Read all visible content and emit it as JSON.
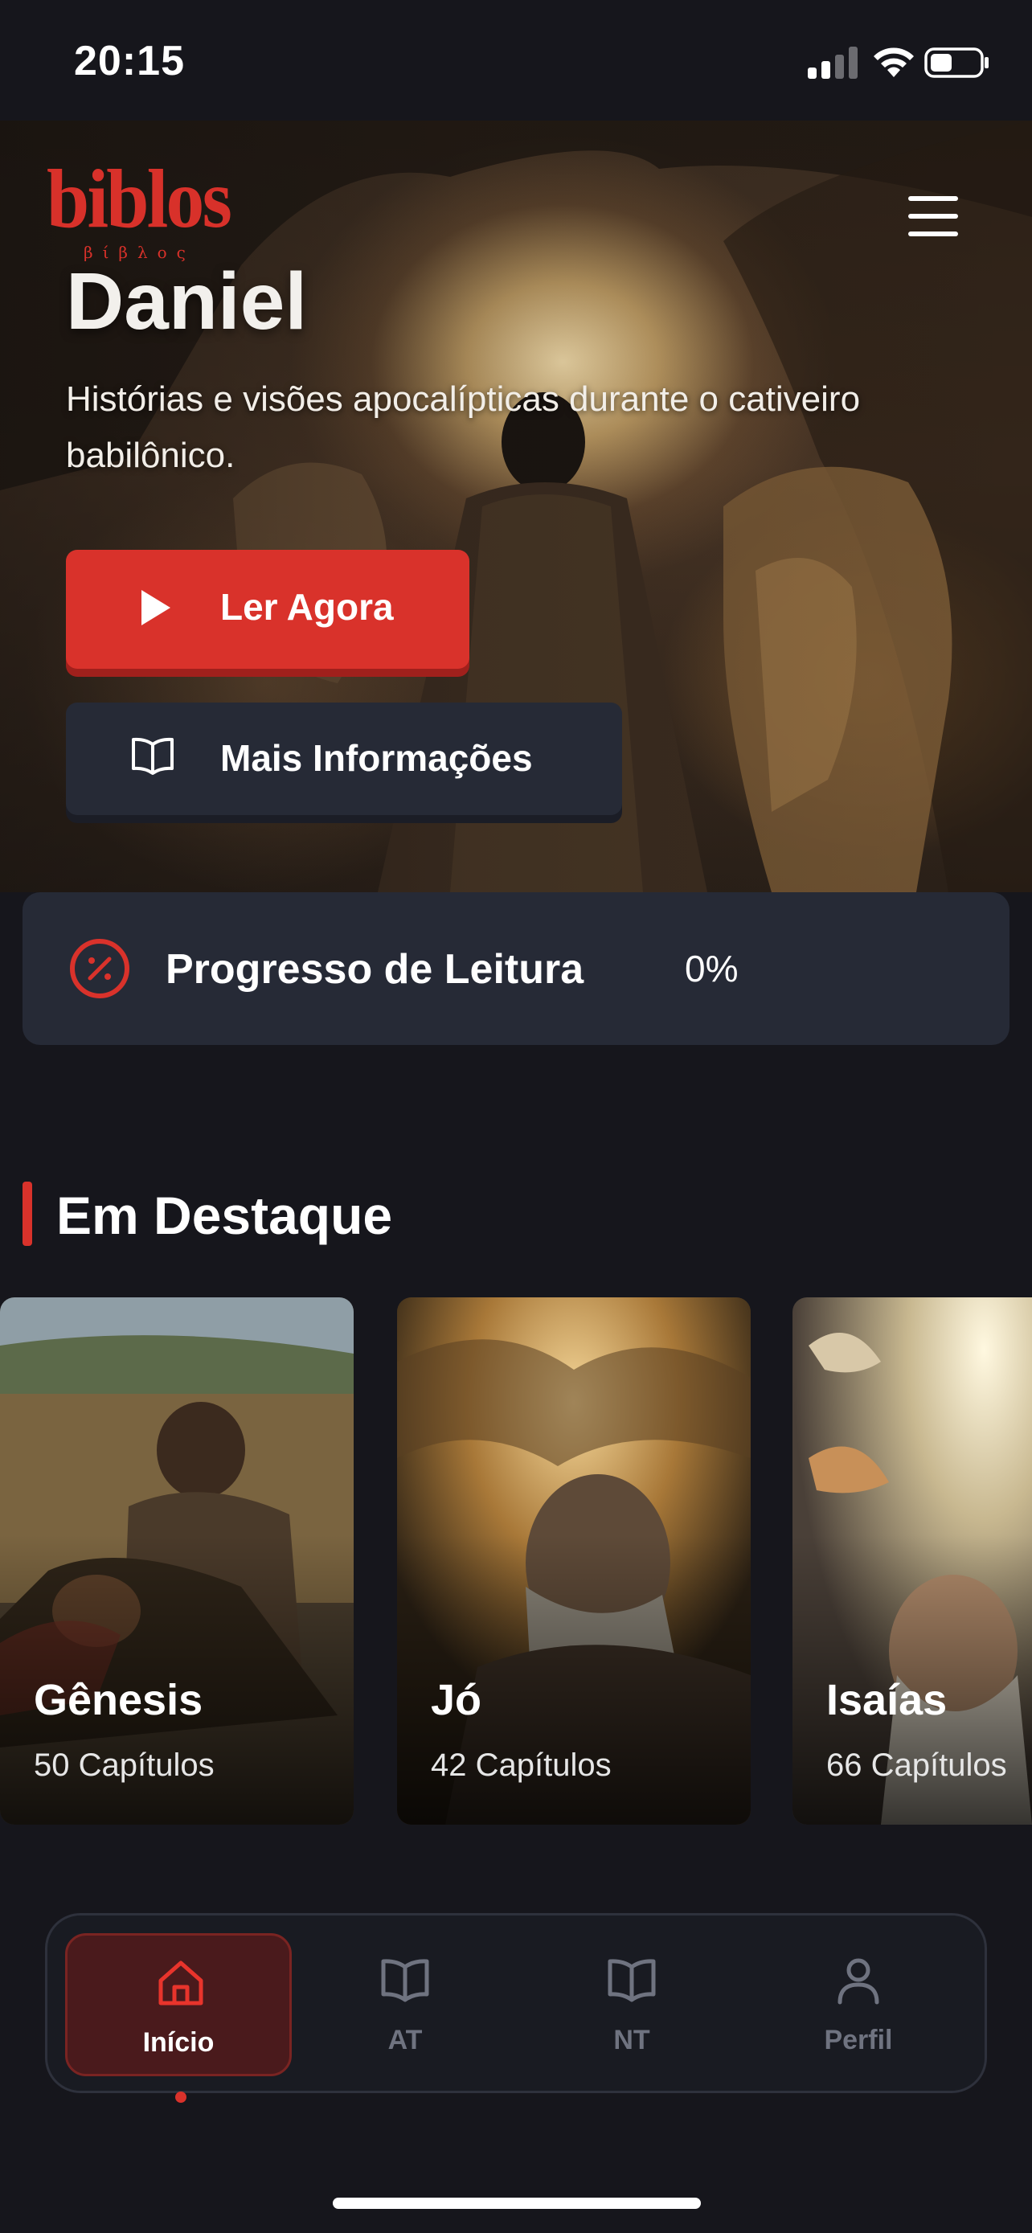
{
  "status_bar": {
    "time": "20:15",
    "icons": [
      "signal-icon",
      "wifi-icon",
      "battery-icon"
    ]
  },
  "header": {
    "logo_text": "biblos",
    "logo_subtext": "βίβλος",
    "menu_icon": "hamburger-menu-icon"
  },
  "hero": {
    "title": "Daniel",
    "description": "Histórias e visões apocalípticas durante o cativeiro babilônico.",
    "primary_button": {
      "label": "Ler Agora",
      "icon": "play-icon"
    },
    "secondary_button": {
      "label": "Mais Informações",
      "icon": "book-open-icon"
    }
  },
  "progress": {
    "label": "Progresso de Leitura",
    "value": "0%",
    "icon": "percent-circle-icon"
  },
  "featured": {
    "title": "Em Destaque",
    "cards": [
      {
        "title": "Gênesis",
        "subtitle": "50 Capítulos"
      },
      {
        "title": "Jó",
        "subtitle": "42 Capítulos"
      },
      {
        "title": "Isaías",
        "subtitle": "66 Capítulos"
      }
    ]
  },
  "bottom_nav": {
    "items": [
      {
        "label": "Início",
        "icon": "home-icon",
        "active": true
      },
      {
        "label": "AT",
        "icon": "book-open-icon",
        "active": false
      },
      {
        "label": "NT",
        "icon": "book-open-icon",
        "active": false
      },
      {
        "label": "Perfil",
        "icon": "user-icon",
        "active": false
      }
    ]
  },
  "colors": {
    "accent": "#d9322b",
    "background": "#16161c",
    "card": "#262a36",
    "nav_inactive": "#6f7380"
  }
}
